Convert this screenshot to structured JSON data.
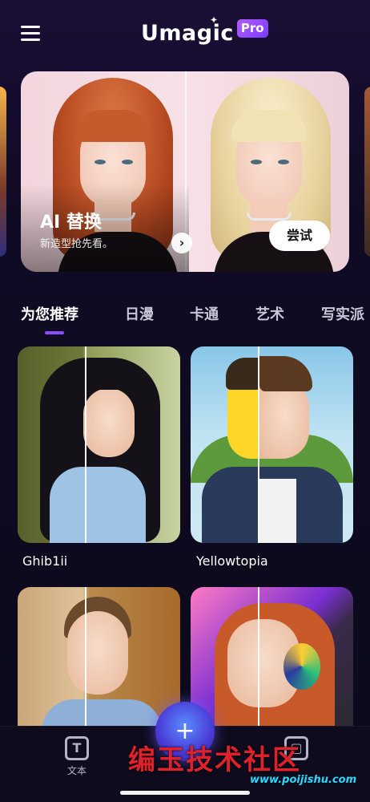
{
  "header": {
    "logo_text": "Umagic",
    "pro_badge": "Pro",
    "menu_icon": "hamburger-menu-icon"
  },
  "banner": {
    "title": "AI 替换",
    "subtitle": "新造型抢先看。",
    "try_label": "尝试",
    "arrow_icon": "chevron-right-icon"
  },
  "tabs": [
    {
      "label": "为您推荐",
      "active": true
    },
    {
      "label": "日漫",
      "active": false
    },
    {
      "label": "卡通",
      "active": false
    },
    {
      "label": "艺术",
      "active": false
    },
    {
      "label": "写实派",
      "active": false
    }
  ],
  "cards": [
    {
      "label": "Ghib1ii"
    },
    {
      "label": "Yellowtopia"
    },
    {
      "label": ""
    },
    {
      "label": ""
    }
  ],
  "bottom_nav": {
    "text_item": {
      "label": "文本",
      "icon": "text-box-icon"
    },
    "center_icon": "create-fab-icon"
  },
  "watermark": {
    "text": "编玉技术社区",
    "url": "www.poijishu.com"
  },
  "colors": {
    "accent": "#8a4dff",
    "background": "#0c0a1c",
    "pro_badge": "#9a4cff"
  }
}
